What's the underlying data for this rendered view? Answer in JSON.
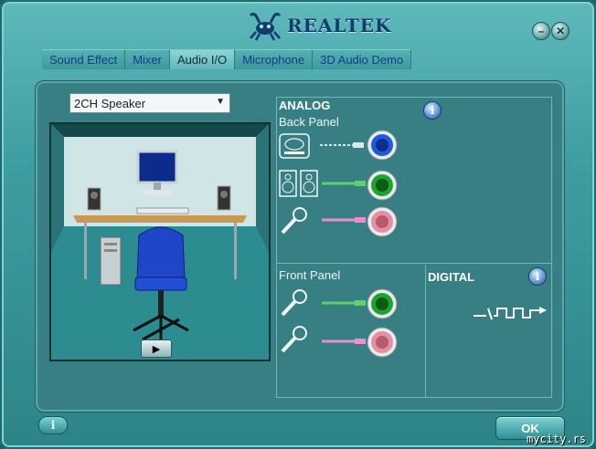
{
  "app": {
    "brand": "REALTEK"
  },
  "window_buttons": {
    "minimize": "–",
    "close": "✕"
  },
  "tabs": [
    {
      "label": "Sound Effect"
    },
    {
      "label": "Mixer"
    },
    {
      "label": "Audio I/O",
      "active": true
    },
    {
      "label": "Microphone"
    },
    {
      "label": "3D Audio Demo"
    }
  ],
  "speaker_select": {
    "value": "2CH Speaker"
  },
  "analog": {
    "title": "ANALOG",
    "back_panel_label": "Back Panel",
    "front_panel_label": "Front Panel",
    "back_jacks": [
      {
        "device": "line-in-device-icon",
        "color": "#1f5bd6"
      },
      {
        "device": "speakers-icon",
        "color": "#1fa32f"
      },
      {
        "device": "microphone-icon",
        "color": "#e68fa3"
      }
    ],
    "front_jacks": [
      {
        "device": "microphone-icon",
        "color": "#1fa32f"
      },
      {
        "device": "microphone-icon",
        "color": "#e68fa3"
      }
    ]
  },
  "digital": {
    "title": "DIGITAL"
  },
  "buttons": {
    "ok": "OK",
    "info_glyph": "i"
  },
  "watermark": "mycity.rs",
  "colors": {
    "accent": "#3f9ea1",
    "tab_text": "#0f3d86"
  }
}
